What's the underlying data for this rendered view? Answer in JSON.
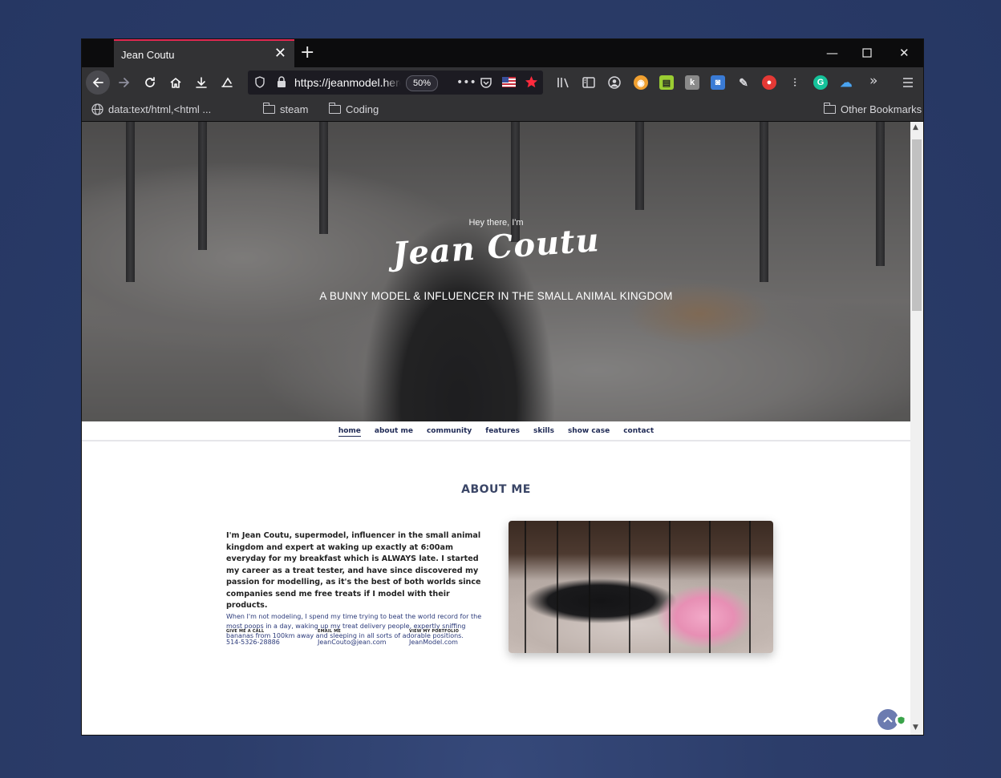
{
  "browser": {
    "tab_title": "Jean Coutu",
    "url": "https://jeanmodel.herokuapp.com",
    "zoom": "50%",
    "bookmarks": {
      "data": "data:text/html,<html ...",
      "steam": "steam",
      "coding": "Coding",
      "other": "Other Bookmarks"
    }
  },
  "hero": {
    "greeting": "Hey there, I'm",
    "name": "Jean Coutu",
    "tagline": "A BUNNY MODEL & INFLUENCER IN THE SMALL ANIMAL KINGDOM"
  },
  "nav": {
    "items": [
      "home",
      "about me",
      "community",
      "features",
      "skills",
      "show case",
      "contact"
    ],
    "active": "home"
  },
  "about": {
    "title": "ABOUT ME",
    "bio": "I'm Jean Coutu, supermodel, influencer in the small animal kingdom and expert at waking up exactly at 6:00am everyday for my breakfast which is ALWAYS late. I started my career as a treat tester, and have since discovered my passion for modelling, as it's the best of both worlds since companies send me free treats if I model with their products.",
    "extra": "When I'm not modeling, I spend my time trying to beat the world record for the most poops in a day, waking up my treat delivery people, expertly sniffing bananas from 100km away and sleeping in all sorts of adorable positions.",
    "contacts": [
      {
        "label": "GIVE ME A CALL",
        "value": "514-5326-28886"
      },
      {
        "label": "EMAIL ME",
        "value": "JeanCouto@jean.com"
      },
      {
        "label": "VIEW MY PORTFOLIO",
        "value": "JeanModel.com"
      }
    ]
  },
  "colors": {
    "accent_tab": "#e22850",
    "nav_text": "#1f2a55",
    "desktop": "#2c3d6a"
  }
}
